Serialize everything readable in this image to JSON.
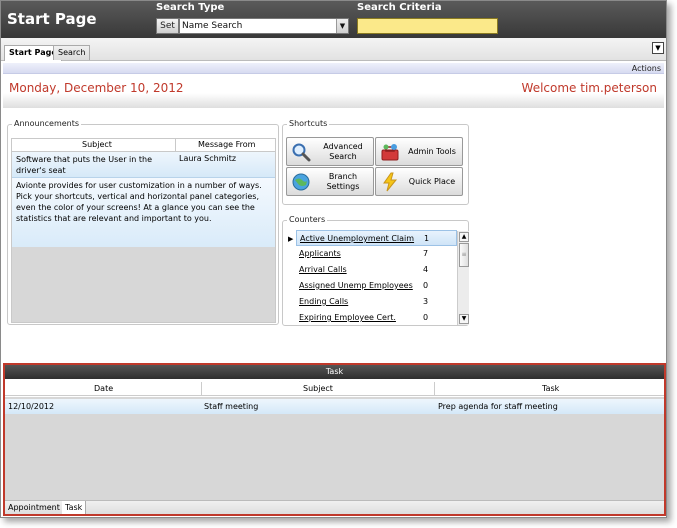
{
  "header": {
    "title": "Start Page",
    "search_type_label": "Search Type",
    "search_criteria_label": "Search Criteria",
    "set_button": "Set",
    "search_type_value": "Name Search",
    "search_criteria_value": ""
  },
  "tabs": [
    {
      "label": "Start Page",
      "active": true
    },
    {
      "label": "Search",
      "active": false
    }
  ],
  "actions_label": "Actions",
  "date_text": "Monday, December 10, 2012",
  "welcome_text": "Welcome tim.peterson",
  "announcements": {
    "title": "Announcements",
    "columns": [
      "Subject",
      "Message From"
    ],
    "row": {
      "subject": "Software that puts the User in the driver's seat",
      "from": "Laura Schmitz",
      "message": "Avionte provides for user customization in a number of ways.  Pick your shortcuts, vertical and horizontal panel categories, even the color of your screens!  At a glance you can see the statistics that are relevant and important  to you."
    }
  },
  "shortcuts": {
    "title": "Shortcuts",
    "items": [
      {
        "label": "Advanced Search",
        "icon": "magnifier-icon"
      },
      {
        "label": "Admin Tools",
        "icon": "toolbox-icon"
      },
      {
        "label": "Branch Settings",
        "icon": "globe-icon"
      },
      {
        "label": "Quick Place",
        "icon": "lightning-icon"
      }
    ]
  },
  "counters": {
    "title": "Counters",
    "rows": [
      {
        "name": "Active Unemployment Claim",
        "value": "1"
      },
      {
        "name": "Applicants",
        "value": "7"
      },
      {
        "name": "Arrival Calls",
        "value": "4"
      },
      {
        "name": "Assigned Unemp Employees",
        "value": "0"
      },
      {
        "name": "Ending Calls",
        "value": "3"
      },
      {
        "name": "Expiring Employee Cert.",
        "value": "0"
      }
    ]
  },
  "task": {
    "title": "Task",
    "columns": [
      "Date",
      "Subject",
      "Task"
    ],
    "row": {
      "date": "12/10/2012",
      "subject": "Staff meeting",
      "task": "Prep agenda for staff meeting"
    },
    "bottom_tabs": [
      {
        "label": "Appointment",
        "active": false
      },
      {
        "label": "Task",
        "active": true
      }
    ]
  },
  "colors": {
    "accent_red": "#c0392b",
    "criteria_yellow": "#fbe98a",
    "header_dark": "#383838"
  }
}
